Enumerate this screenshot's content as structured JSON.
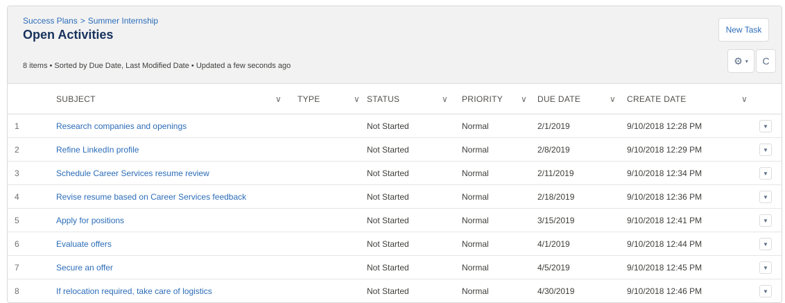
{
  "breadcrumb": {
    "parent": "Success Plans",
    "separator": ">",
    "current": "Summer Internship"
  },
  "title": "Open Activities",
  "meta": "8 items • Sorted by Due Date, Last Modified Date • Updated a few seconds ago",
  "actions": {
    "new_task": "New Task",
    "gear_icon": "⚙",
    "caret": "▾",
    "refresh_icon": "C"
  },
  "columns": [
    "SUBJECT",
    "TYPE",
    "STATUS",
    "PRIORITY",
    "DUE DATE",
    "CREATE DATE"
  ],
  "column_caret": "∨",
  "row_action_icon": "▼",
  "rows": [
    {
      "num": "1",
      "subject": "Research companies and openings",
      "type": "",
      "status": "Not Started",
      "priority": "Normal",
      "due": "2/1/2019",
      "created": "9/10/2018 12:28 PM"
    },
    {
      "num": "2",
      "subject": "Refine LinkedIn profile",
      "type": "",
      "status": "Not Started",
      "priority": "Normal",
      "due": "2/8/2019",
      "created": "9/10/2018 12:29 PM"
    },
    {
      "num": "3",
      "subject": "Schedule Career Services resume review",
      "type": "",
      "status": "Not Started",
      "priority": "Normal",
      "due": "2/11/2019",
      "created": "9/10/2018 12:34 PM"
    },
    {
      "num": "4",
      "subject": "Revise resume based on Career Services feedback",
      "type": "",
      "status": "Not Started",
      "priority": "Normal",
      "due": "2/18/2019",
      "created": "9/10/2018 12:36 PM"
    },
    {
      "num": "5",
      "subject": "Apply for positions",
      "type": "",
      "status": "Not Started",
      "priority": "Normal",
      "due": "3/15/2019",
      "created": "9/10/2018 12:41 PM"
    },
    {
      "num": "6",
      "subject": "Evaluate offers",
      "type": "",
      "status": "Not Started",
      "priority": "Normal",
      "due": "4/1/2019",
      "created": "9/10/2018 12:44 PM"
    },
    {
      "num": "7",
      "subject": "Secure an offer",
      "type": "",
      "status": "Not Started",
      "priority": "Normal",
      "due": "4/5/2019",
      "created": "9/10/2018 12:45 PM"
    },
    {
      "num": "8",
      "subject": "If relocation required, take care of logistics",
      "type": "",
      "status": "Not Started",
      "priority": "Normal",
      "due": "4/30/2019",
      "created": "9/10/2018 12:46 PM"
    }
  ],
  "colors": {
    "link": "#2b6cb8",
    "header_bg": "#f3f2f2",
    "title": "#16325c",
    "border": "#dddbda"
  }
}
